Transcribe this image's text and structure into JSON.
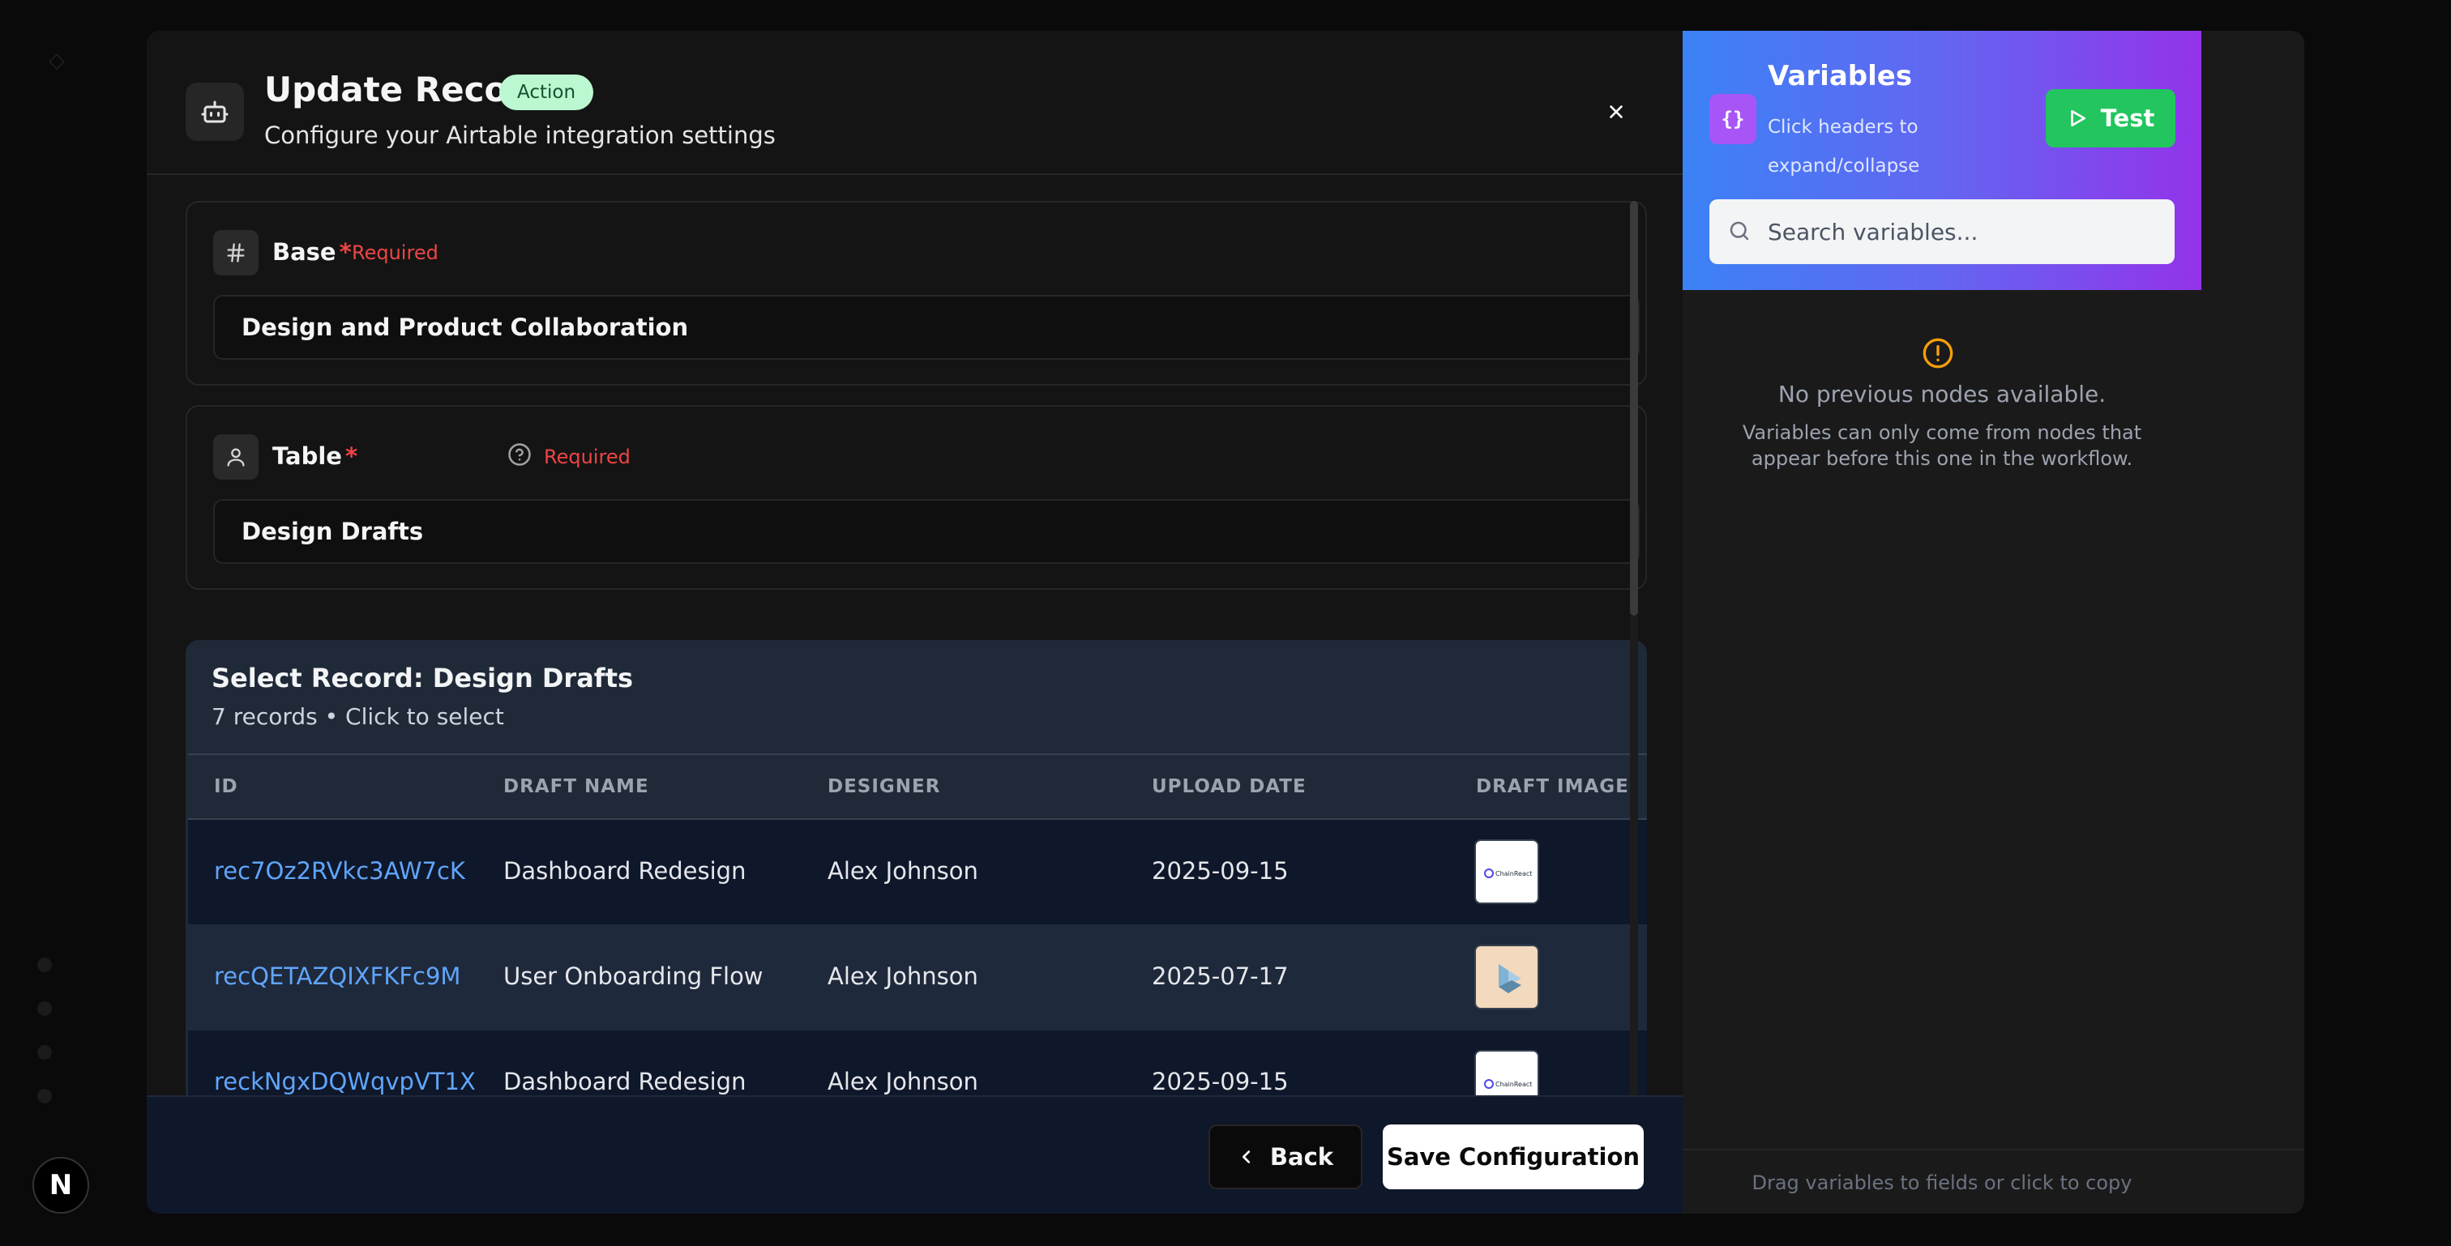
{
  "modal": {
    "title": "Update Record",
    "badge": "Action",
    "subtitle": "Configure your Airtable integration settings"
  },
  "fields": {
    "base": {
      "label": "Base",
      "star": "*",
      "required": "Required",
      "value": "Design and Product Collaboration"
    },
    "table": {
      "label": "Table",
      "star": "*",
      "required": "Required",
      "value": "Design Drafts"
    }
  },
  "record_panel": {
    "title": "Select Record: Design Drafts",
    "subtitle": "7 records • Click to select",
    "columns": [
      "ID",
      "DRAFT NAME",
      "DESIGNER",
      "UPLOAD DATE",
      "DRAFT IMAGE"
    ],
    "rows": [
      {
        "id": "rec7Oz2RVkc3AW7cK",
        "name": "Dashboard Redesign",
        "designer": "Alex Johnson",
        "date": "2025-09-15",
        "thumb_text": "ChainReact"
      },
      {
        "id": "recQETAZQIXFKFc9M",
        "name": "User Onboarding Flow",
        "designer": "Alex Johnson",
        "date": "2025-07-17",
        "thumb_text": ""
      },
      {
        "id": "reckNgxDQWqvpVT1X",
        "name": "Dashboard Redesign",
        "designer": "Alex Johnson",
        "date": "2025-09-15",
        "thumb_text": "ChainReact"
      }
    ]
  },
  "footer": {
    "back_label": "Back",
    "save_label": "Save Configuration"
  },
  "variables": {
    "title": "Variables",
    "hint": "Click headers to expand/collapse",
    "test_label": "Test",
    "search_placeholder": "Search variables...",
    "empty_title": "No previous nodes available.",
    "empty_desc": "Variables can only come from nodes that appear before this one in the workflow.",
    "footer_text": "Drag variables to fields or click to copy"
  },
  "logo_letter": "N",
  "colors": {
    "accent_blue": "#60a5fa",
    "required_red": "#ef4444",
    "badge_green": "#bbf7d0",
    "test_green": "#22c55e",
    "gradient": [
      "#3b82f6",
      "#9333ea"
    ]
  }
}
